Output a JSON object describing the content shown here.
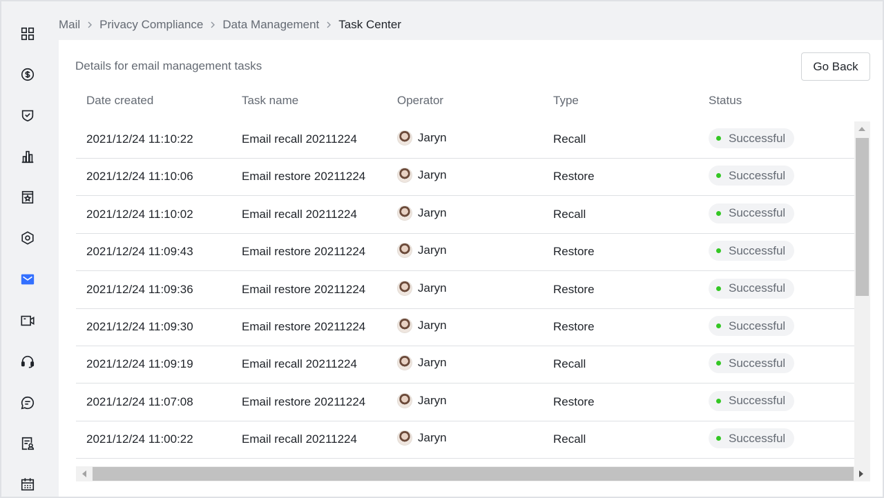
{
  "sidebar": {
    "items": [
      {
        "icon": "grid-icon"
      },
      {
        "icon": "dollar-icon"
      },
      {
        "icon": "shield-check-icon"
      },
      {
        "icon": "bar-chart-icon"
      },
      {
        "icon": "star-doc-icon"
      },
      {
        "icon": "hexagon-icon"
      },
      {
        "icon": "mail-icon",
        "active": true
      },
      {
        "icon": "video-icon"
      },
      {
        "icon": "headset-icon"
      },
      {
        "icon": "chat-icon"
      },
      {
        "icon": "doc-user-icon"
      },
      {
        "icon": "calendar-icon"
      }
    ],
    "active_color": "#3370ff",
    "icon_color": "#1f2329"
  },
  "breadcrumb": {
    "items": [
      "Mail",
      "Privacy Compliance",
      "Data Management",
      "Task Center"
    ]
  },
  "card": {
    "title": "Details for email management tasks",
    "go_back_label": "Go Back"
  },
  "table": {
    "columns": [
      "Date created",
      "Task name",
      "Operator",
      "Type",
      "Status"
    ],
    "rows": [
      {
        "date": "2021/12/24 11:10:22",
        "task": "Email recall 20211224",
        "operator": "Jaryn",
        "type": "Recall",
        "status": "Successful"
      },
      {
        "date": "2021/12/24 11:10:06",
        "task": "Email restore 20211224",
        "operator": "Jaryn",
        "type": "Restore",
        "status": "Successful"
      },
      {
        "date": "2021/12/24 11:10:02",
        "task": "Email recall 20211224",
        "operator": "Jaryn",
        "type": "Recall",
        "status": "Successful"
      },
      {
        "date": "2021/12/24 11:09:43",
        "task": "Email restore 20211224",
        "operator": "Jaryn",
        "type": "Restore",
        "status": "Successful"
      },
      {
        "date": "2021/12/24 11:09:36",
        "task": "Email restore 20211224",
        "operator": "Jaryn",
        "type": "Restore",
        "status": "Successful"
      },
      {
        "date": "2021/12/24 11:09:30",
        "task": "Email restore 20211224",
        "operator": "Jaryn",
        "type": "Restore",
        "status": "Successful"
      },
      {
        "date": "2021/12/24 11:09:19",
        "task": "Email recall 20211224",
        "operator": "Jaryn",
        "type": "Recall",
        "status": "Successful"
      },
      {
        "date": "2021/12/24 11:07:08",
        "task": "Email restore 20211224",
        "operator": "Jaryn",
        "type": "Restore",
        "status": "Successful"
      },
      {
        "date": "2021/12/24 11:00:22",
        "task": "Email recall 20211224",
        "operator": "Jaryn",
        "type": "Recall",
        "status": "Successful"
      }
    ],
    "status_color": "#34c724"
  }
}
